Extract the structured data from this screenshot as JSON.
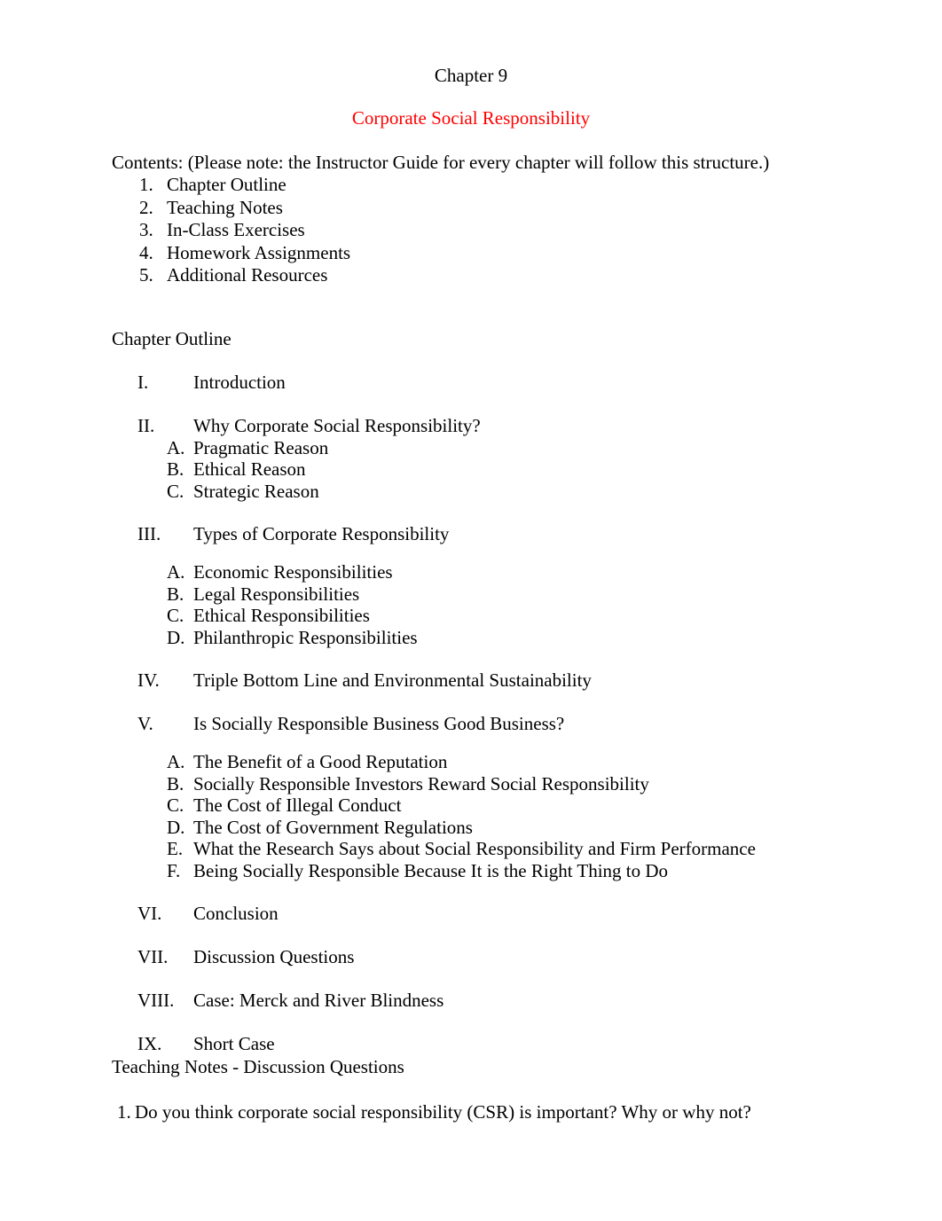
{
  "document": {
    "chapter_title": "Chapter 9",
    "subject_title": "Corporate Social Responsibility",
    "subject_title_color": "#FF0000",
    "contents_intro": "Contents:  (Please note: the Instructor Guide for every chapter will follow this structure.)",
    "contents_items": [
      {
        "number": "1.",
        "label": "Chapter Outline"
      },
      {
        "number": "2.",
        "label": "Teaching Notes"
      },
      {
        "number": "3.",
        "label": "In-Class Exercises"
      },
      {
        "number": "4.",
        "label": "Homework Assignments"
      },
      {
        "number": "5.",
        "label": "Additional Resources"
      }
    ],
    "outline_heading": "Chapter Outline",
    "outline": [
      {
        "numeral": "I.",
        "title": "Introduction",
        "subitems": []
      },
      {
        "numeral": "II.",
        "title": "Why Corporate Social Responsibility?",
        "sub_gap": false,
        "subitems": [
          {
            "letter": "A.",
            "label": "Pragmatic Reason"
          },
          {
            "letter": "B.",
            "label": "Ethical Reason"
          },
          {
            "letter": "C.",
            "label": "Strategic Reason"
          }
        ]
      },
      {
        "numeral": "III.",
        "title": "Types of Corporate Responsibility",
        "sub_gap": true,
        "subitems": [
          {
            "letter": "A.",
            "label": "Economic Responsibilities"
          },
          {
            "letter": "B.",
            "label": "Legal Responsibilities"
          },
          {
            "letter": "C.",
            "label": "Ethical Responsibilities"
          },
          {
            "letter": "D.",
            "label": "Philanthropic Responsibilities"
          }
        ]
      },
      {
        "numeral": "IV.",
        "title": "Triple Bottom Line and Environmental Sustainability",
        "subitems": []
      },
      {
        "numeral": "V.",
        "title": "Is Socially Responsible Business Good Business?",
        "sub_gap": true,
        "subitems": [
          {
            "letter": "A.",
            "label": "The Benefit of a Good Reputation"
          },
          {
            "letter": "B.",
            "label": "Socially Responsible Investors Reward Social Responsibility"
          },
          {
            "letter": "C.",
            "label": "The Cost of Illegal Conduct"
          },
          {
            "letter": "D.",
            "label": "The Cost of Government Regulations"
          },
          {
            "letter": "E.",
            "label": "What the Research Says about Social Responsibility and Firm Performance"
          },
          {
            "letter": "F.",
            "label": "Being Socially Responsible Because It is the Right Thing to Do"
          }
        ]
      },
      {
        "numeral": "VI.",
        "title": "Conclusion",
        "subitems": []
      },
      {
        "numeral": "VII.",
        "title": "Discussion Questions",
        "subitems": []
      },
      {
        "numeral": "VIII.",
        "title": "Case: Merck and River Blindness",
        "subitems": []
      },
      {
        "numeral": "IX.",
        "title": "Short Case",
        "subitems": []
      }
    ],
    "teaching_notes_heading": "Teaching Notes - Discussion Questions",
    "discussion_questions": [
      {
        "number": "1.",
        "text": "Do you think corporate social responsibility (CSR) is important? Why or why not?"
      }
    ]
  }
}
